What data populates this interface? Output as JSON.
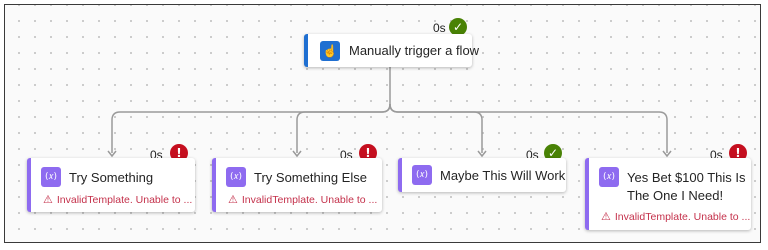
{
  "trigger": {
    "label": "Manually trigger a flow",
    "duration": "0s",
    "status": "success",
    "icon": "hand-tap-icon"
  },
  "actions": [
    {
      "title": "Try Something",
      "duration": "0s",
      "status": "failed",
      "error": "InvalidTemplate. Unable to ..."
    },
    {
      "title": "Try Something Else",
      "duration": "0s",
      "status": "failed",
      "error": "InvalidTemplate. Unable to ..."
    },
    {
      "title": "Maybe This Will Work",
      "duration": "0s",
      "status": "success",
      "error": ""
    },
    {
      "title": "Yes Bet $100 This Is The One I Need!",
      "duration": "0s",
      "status": "failed",
      "error": "InvalidTemplate. Unable to ..."
    }
  ],
  "colors": {
    "trigger_accent": "#1f6fd1",
    "action_accent": "#8e6bf0",
    "success": "#498205",
    "failure": "#c50f1f",
    "error_text": "#c4314b"
  },
  "icons": {
    "action": "expression-icon",
    "success": "checkmark-icon",
    "failure": "exclamation-icon",
    "warning": "warning-icon"
  }
}
